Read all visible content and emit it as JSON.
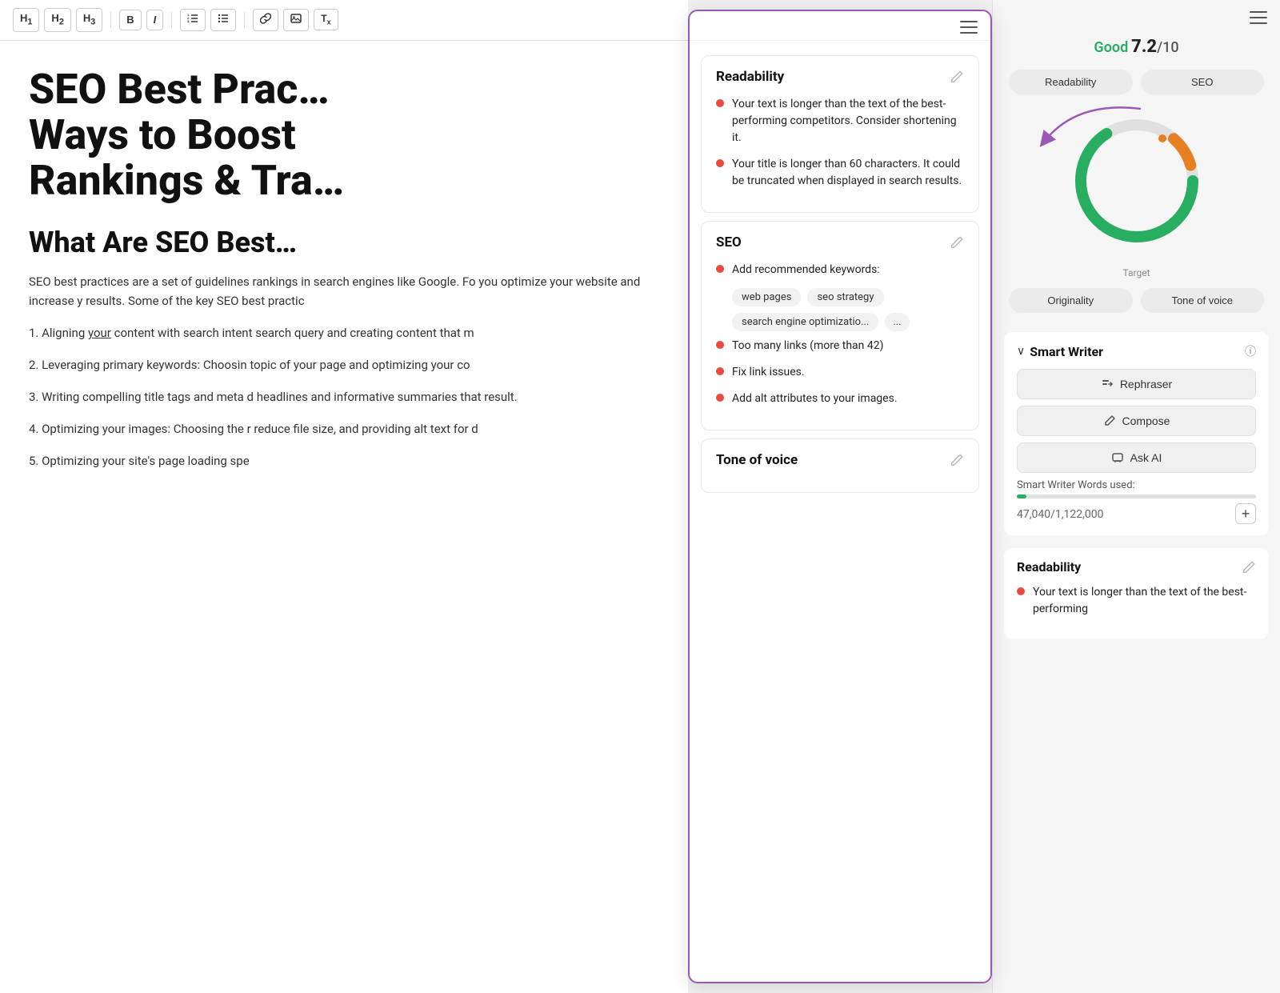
{
  "toolbar": {
    "buttons": [
      {
        "label": "H1",
        "name": "h1-button"
      },
      {
        "label": "H2",
        "name": "h2-button"
      },
      {
        "label": "H3",
        "name": "h3-button"
      },
      {
        "label": "B",
        "name": "bold-button"
      },
      {
        "label": "I",
        "name": "italic-button"
      },
      {
        "label": "OL",
        "name": "ordered-list-button"
      },
      {
        "label": "UL",
        "name": "unordered-list-button"
      },
      {
        "label": "🔗",
        "name": "link-button"
      },
      {
        "label": "🖼",
        "name": "image-button"
      },
      {
        "label": "Tx",
        "name": "clear-format-button"
      }
    ]
  },
  "editor": {
    "title": "SEO Best Practices: Ways to Boost Rankings & Tra…",
    "subtitle": "What Are SEO Best…",
    "paragraphs": [
      "SEO best practices are a set of guidelines rankings in search engines like Google. Fo you optimize your website and increase y results. Some of the key SEO best practic",
      "1. Aligning your content with search intent search query and creating content that m",
      "2. Leveraging primary keywords: Choosin topic of your page and optimizing your co",
      "3. Writing compelling title tags and meta d headlines and informative summaries that result.",
      "4. Optimizing your images: Choosing the r reduce file size, and providing alt text for d",
      "5. Optimizing your site's page loading spe"
    ]
  },
  "overlay": {
    "menu_icon": "≡",
    "sections": [
      {
        "id": "readability",
        "title": "Readability",
        "items": [
          "Your text is longer than the text of the best-performing competitors. Consider shortening it.",
          "Your title is longer than 60 characters. It could be truncated when displayed in search results."
        ]
      },
      {
        "id": "seo",
        "title": "SEO",
        "items_before_tags": [
          "Add recommended keywords:"
        ],
        "keywords": [
          "web pages",
          "seo strategy",
          "search engine optimizatio...",
          "..."
        ],
        "items_after_tags": [
          "Too many links (more than 42)",
          "Fix link issues.",
          "Add alt attributes to your images."
        ]
      },
      {
        "id": "tone-of-voice",
        "title": "Tone of voice"
      }
    ]
  },
  "right_panel": {
    "score_label": "Good",
    "score_value": "7.2",
    "score_total": "/10",
    "tabs_top": [
      "Readability",
      "SEO"
    ],
    "tabs_bottom": [
      "Originality",
      "Tone of voice"
    ],
    "chart": {
      "target_label": "Target"
    },
    "smart_writer": {
      "title": "Smart Writer",
      "buttons": [
        "Rephraser",
        "Compose",
        "Ask AI"
      ],
      "words_used_label": "Smart Writer Words used:",
      "words_count": "47,040",
      "words_limit": "1,122,000",
      "progress_percent": 4
    },
    "readability": {
      "title": "Readability",
      "items": [
        "Your text is longer than the text of the best-performing"
      ]
    }
  }
}
